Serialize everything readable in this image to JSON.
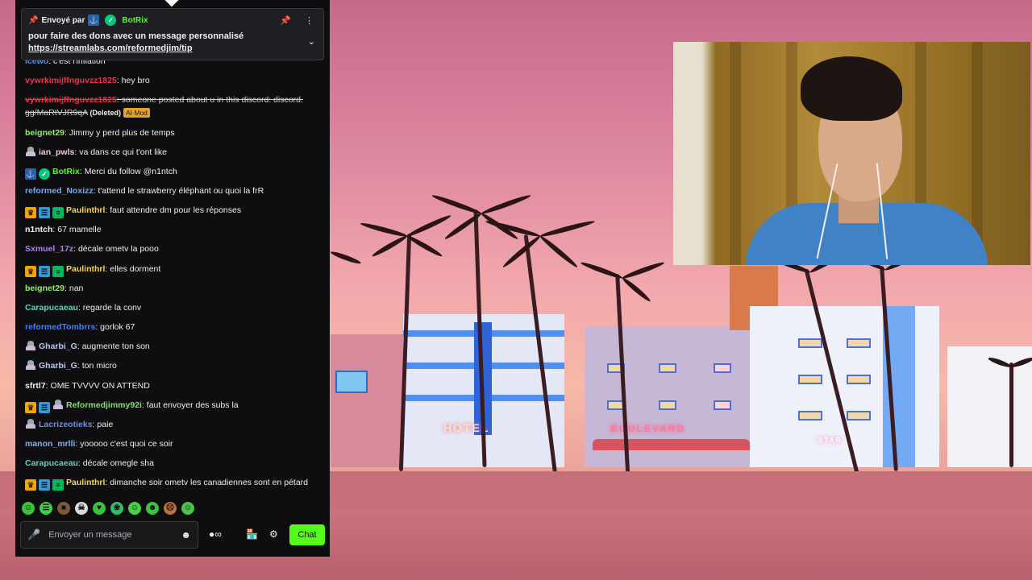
{
  "colors": {
    "chat_bg": "#0e0e10",
    "accent_green": "#53fc18",
    "ai_mod_tag": "#e6a02b"
  },
  "scene": {
    "neon_signs": [
      "HOTEL",
      "BOULEVARD",
      "STAR"
    ]
  },
  "pinned": {
    "sent_by_label": "Envoyé par",
    "sender": "BotRix",
    "message": "pour faire des dons avec un message personnalisé",
    "link": "https://streamlabs.com/reformedjim/tip",
    "icons": [
      "pin-icon",
      "mod-badge-icon",
      "verified-badge-icon",
      "pin-action-icon",
      "more-icon",
      "chevron-down-icon"
    ]
  },
  "messages": [
    {
      "user": "icewo",
      "color": "#5b8ef0",
      "text": "c'est l'inflation",
      "badges": []
    },
    {
      "user": "vywrkimijffnguvzz1825",
      "color": "#e8334a",
      "text": "hey bro",
      "badges": []
    },
    {
      "user": "vywrkimijffnguvzz1825",
      "color": "#e8334a",
      "text": "someone posted about u in this discord: discord. gg/MaRtVJR9qA",
      "deleted_label": "(Deleted)",
      "tag": "AI Mod",
      "badges": []
    },
    {
      "user": "beignet29",
      "color": "#9be86f",
      "text": "Jimmy y perd plus de temps",
      "badges": []
    },
    {
      "user": "ian_pwls",
      "color": "#e9c8de",
      "text": "va dans ce qui t'ont like",
      "badges": [
        "avatar"
      ]
    },
    {
      "user": "BotRix",
      "color": "#53fc18",
      "text": "Merci du follow @n1ntch",
      "badges": [
        "mod",
        "verified"
      ]
    },
    {
      "user": "reformed_Noxizz",
      "color": "#74a7f5",
      "text": "t'attend le strawberry éléphant ou quoi la frR",
      "badges": []
    },
    {
      "user": "Paulinthrl",
      "color": "#f4d35e",
      "text": "faut attendre dm pour les réponses",
      "badges": [
        "crown",
        "sub",
        "green"
      ]
    },
    {
      "user": "n1ntch",
      "color": "#efeff1",
      "text": "67 mamelle",
      "badges": []
    },
    {
      "user": "Sxmuel_17z",
      "color": "#b57bf2",
      "text": "décale ometv la pooo",
      "badges": []
    },
    {
      "user": "Paulinthrl",
      "color": "#f4d35e",
      "text": "elles dorment",
      "badges": [
        "crown",
        "sub",
        "green"
      ]
    },
    {
      "user": "beignet29",
      "color": "#9be86f",
      "text": "nan",
      "badges": []
    },
    {
      "user": "Carapucaeau",
      "color": "#5fd3bc",
      "text": "regarde la conv",
      "badges": []
    },
    {
      "user": "reformedTombrrs",
      "color": "#4c7df0",
      "text": "gorlok 67",
      "badges": []
    },
    {
      "user": "Gharbi_G",
      "color": "#b9c6f0",
      "text": "augmente ton son",
      "badges": [
        "avatar"
      ]
    },
    {
      "user": "Gharbi_G",
      "color": "#b9c6f0",
      "text": "ton micro",
      "badges": [
        "avatar"
      ]
    },
    {
      "user": "sfrtl7",
      "color": "#efeff1",
      "text": "OME TVVVV ON ATTEND",
      "badges": []
    },
    {
      "user": "Reformedjimmy92i",
      "color": "#7ee06a",
      "text": "faut envoyer des subs la",
      "badges": [
        "crown",
        "sub",
        "avatar"
      ]
    },
    {
      "user": "Lacrizeotieks",
      "color": "#6a8ef0",
      "text": "paie",
      "badges": [
        "avatar"
      ]
    },
    {
      "user": "manon_mrlli",
      "color": "#7fb0f5",
      "text": "yooooo c'est quoi ce soir",
      "badges": []
    },
    {
      "user": "Carapucaeau",
      "color": "#5fd3bc",
      "text": "décale omegle sha",
      "badges": []
    },
    {
      "user": "Paulinthrl",
      "color": "#f4d35e",
      "text": "dimanche soir ometv les canadiennes sont en pétard",
      "badges": [
        "crown",
        "sub",
        "green"
      ]
    }
  ],
  "emotes": [
    "emote-1",
    "emote-2",
    "emote-3",
    "emote-4",
    "emote-5",
    "emote-6",
    "emote-7",
    "emote-8",
    "emote-9",
    "emote-10"
  ],
  "input": {
    "placeholder": "Envoyer un message"
  },
  "buttons": {
    "chat_label": "Chat"
  }
}
